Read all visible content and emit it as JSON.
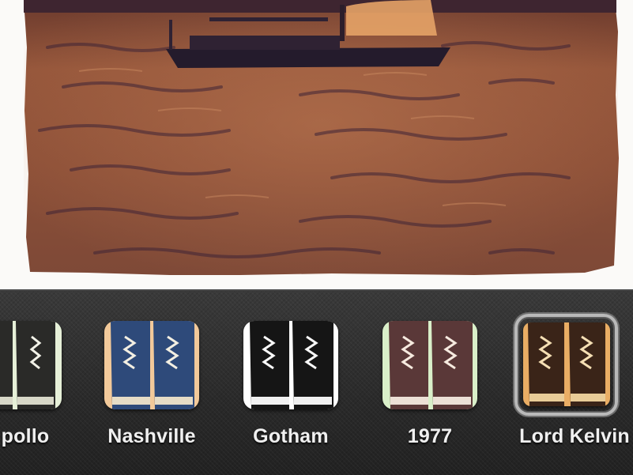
{
  "preview": {
    "subject": "sailboat-on-water-photo",
    "tint_color": "#8a4b2c"
  },
  "filters": [
    {
      "label": "pollo",
      "tint": "#e6f0d8",
      "selected": false
    },
    {
      "label": "Nashville",
      "tint": "#f2c99a",
      "selected": false
    },
    {
      "label": "Gotham",
      "tint": "#ffffff",
      "selected": false
    },
    {
      "label": "1977",
      "tint": "#d9efc9",
      "selected": false
    },
    {
      "label": "Lord Kelvin",
      "tint": "#e9ad64",
      "selected": true
    }
  ],
  "colors": {
    "strip_background": "#2f2f2f",
    "label_text": "#f0f0f0",
    "selection_ring": "#b9b9b9"
  }
}
